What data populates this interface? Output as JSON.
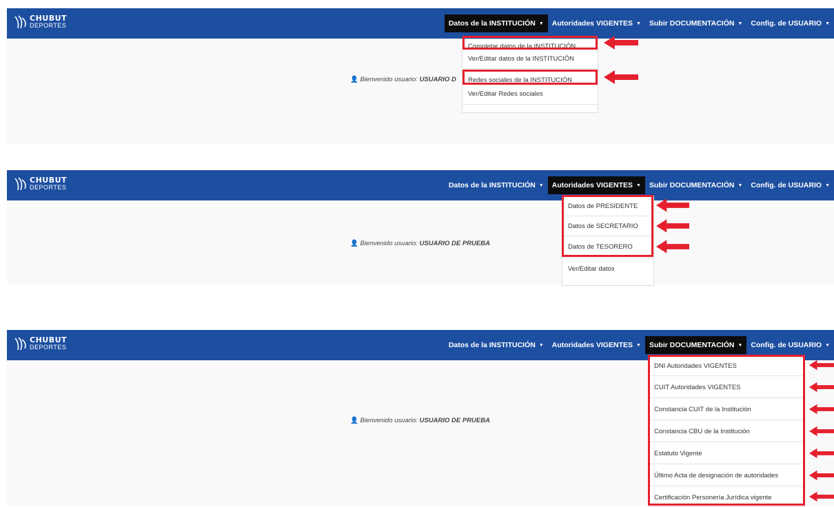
{
  "brand": {
    "line1": "CHUBUT",
    "line2": "DEPORTES"
  },
  "nav": {
    "institucion": "Datos de la INSTITUCIÓN",
    "autoridades": "Autoridades VIGENTES",
    "documentacion": "Subir DOCUMENTACIÓN",
    "config": "Config. de USUARIO"
  },
  "welcome": {
    "prefix": "Bienvenido usuario: ",
    "user": "USUARIO DE PRUEBA",
    "user_truncated": "USUARIO D"
  },
  "institucion_menu": [
    "Completar datos de la INSTITUCIÓN",
    "Ver/Editar datos de la INSTITUCIÓN",
    "Redes sociales de la INSTITUCIÓN",
    "Ver/Editar Redes sociales"
  ],
  "autoridades_menu": [
    "Datos de PRESIDENTE",
    "Datos de SECRETARIO",
    "Datos de TESORERO",
    "Ver/Editar datos"
  ],
  "documentacion_menu": [
    "DNI Autoridades VIGENTES",
    "CUIT Autoridades VIGENTES",
    "Constancia CUIT de la Institución",
    "Constancia CBU de la Institución",
    "Estatuto Vigente",
    "Último Acta de designación de autoridades",
    "Certificación Personería Jurídica vigente"
  ],
  "colors": {
    "navbar": "#1d4fa0",
    "active_menu": "#0c0c0c",
    "highlight": "#e5202e",
    "page": "#f9f9f9"
  }
}
